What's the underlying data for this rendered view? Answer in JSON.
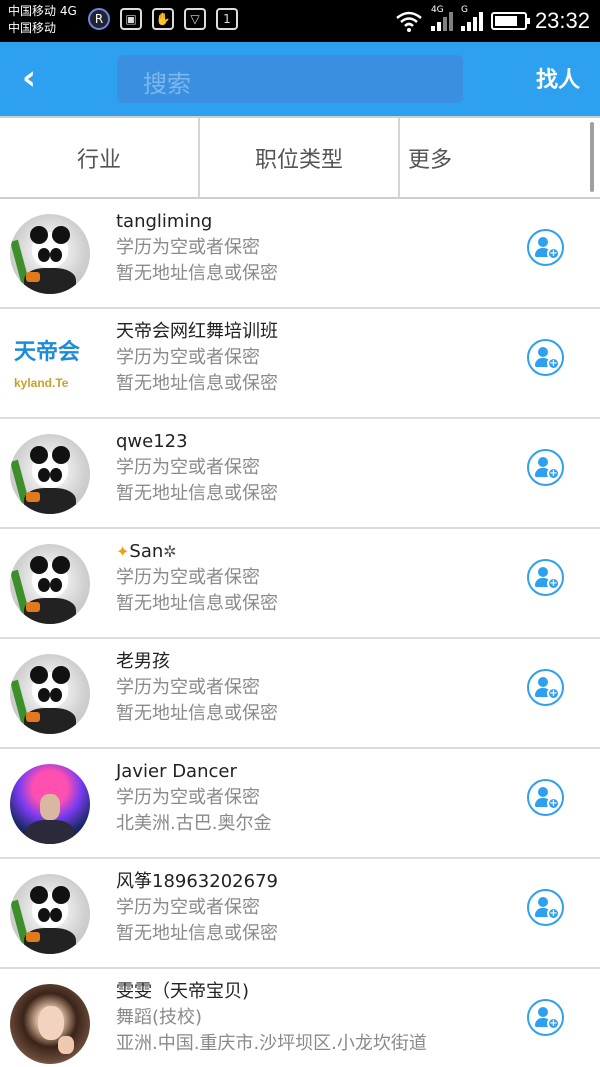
{
  "status_bar": {
    "carrier_line1": "中国移动 4G",
    "carrier_line2": "中国移动",
    "net_4g": "4G",
    "net_g": "G",
    "time": "23:32"
  },
  "header": {
    "back_icon": "chevron-left-icon",
    "search_placeholder": "搜索",
    "find_label": "找人"
  },
  "filters": {
    "industry": "行业",
    "job_type": "职位类型",
    "more": "更多"
  },
  "users": [
    {
      "name": "tangliming",
      "education": "学历为空或者保密",
      "address": "暂无地址信息或保密"
    },
    {
      "name": "天帝会网红舞培训班",
      "education": "学历为空或者保密",
      "address": "暂无地址信息或保密",
      "logo_top": "天帝会",
      "logo_bottom": "kyland.Te"
    },
    {
      "name": "qwe123",
      "education": "学历为空或者保密",
      "address": "暂无地址信息或保密"
    },
    {
      "name": "San",
      "education": "学历为空或者保密",
      "address": "暂无地址信息或保密"
    },
    {
      "name": "老男孩",
      "education": "学历为空或者保密",
      "address": "暂无地址信息或保密"
    },
    {
      "name": "Javier Dancer",
      "education": "学历为空或者保密",
      "address": "北美洲.古巴.奥尔金"
    },
    {
      "name": "风筝18963202679",
      "education": "学历为空或者保密",
      "address": "暂无地址信息或保密"
    },
    {
      "name": "雯雯（天帝宝贝)",
      "education": "舞蹈(技校)",
      "address": "亚洲.中国.重庆市.沙坪坝区.小龙坎街道"
    }
  ],
  "colors": {
    "accent": "#2ea0f0",
    "search_bg": "#3a8fe0"
  }
}
